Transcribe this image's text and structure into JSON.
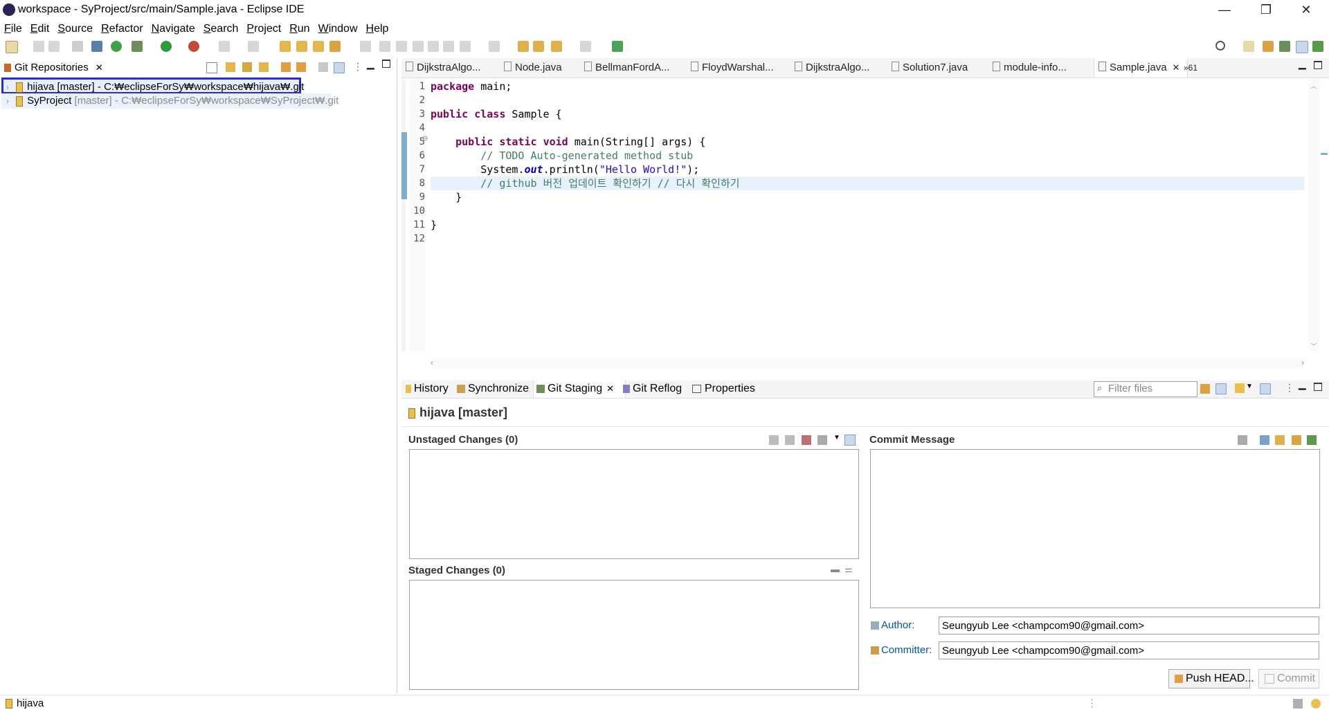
{
  "window": {
    "title": "workspace - SyProject/src/main/Sample.java - Eclipse IDE",
    "minimize": "—",
    "restore": "❐",
    "close": "✕"
  },
  "menu": [
    "File",
    "Edit",
    "Source",
    "Refactor",
    "Navigate",
    "Search",
    "Project",
    "Run",
    "Window",
    "Help"
  ],
  "git_repos_view": {
    "tab_label": "Git Repositories",
    "repos": [
      {
        "name": "hijava",
        "branch": "[master]",
        "path": "- C:₩eclipseForSy₩workspace₩hijava₩.git",
        "selected": true
      },
      {
        "name": "SyProject",
        "branch": "[master]",
        "path": "- C:₩eclipseForSy₩workspace₩SyProject₩.git",
        "selected": false
      }
    ]
  },
  "editor": {
    "tabs": [
      "DijkstraAlgo...",
      "Node.java",
      "BellmanFordA...",
      "FloydWarshal...",
      "DijkstraAlgo...",
      "Solution7.java",
      "module-info...",
      "Sample.java"
    ],
    "active_tab": "Sample.java",
    "overflow_count": "»61",
    "line_numbers": [
      "1",
      "2",
      "3",
      "4",
      "5",
      "6",
      "7",
      "8",
      "9",
      "10",
      "11",
      "12"
    ],
    "code": {
      "l1_kw": "package",
      "l1_rest": " main;",
      "l3_kw1": "public",
      "l3_kw2": "class",
      "l3_rest": " Sample {",
      "l5_kw1": "public",
      "l5_kw2": "static",
      "l5_kw3": "void",
      "l5_rest": " main(String[] args) {",
      "l6": "// TODO Auto-generated method stub",
      "l7_a": "System.",
      "l7_field": "out",
      "l7_b": ".println(",
      "l7_str": "\"Hello World!\"",
      "l7_c": ");",
      "l8": "// github 버전 업데이트 확인하기 // 다시 확인하기",
      "l9": "}",
      "l11": "}"
    }
  },
  "bottom_view": {
    "tabs": [
      "History",
      "Synchronize",
      "Git Staging",
      "Git Reflog",
      "Properties"
    ],
    "active_tab": "Git Staging",
    "filter_placeholder": "Filter files",
    "repo_header": "hijava [master]",
    "unstaged_label": "Unstaged Changes (0)",
    "staged_label": "Staged Changes (0)",
    "commit_message_label": "Commit Message",
    "author_label": "Author:",
    "author_value": "Seungyub Lee <champcom90@gmail.com>",
    "committer_label": "Committer:",
    "committer_value": "Seungyub Lee <champcom90@gmail.com>",
    "push_button": "Push HEAD...",
    "commit_button": "Commit"
  },
  "status_bar": {
    "text": "hijava"
  },
  "colors": {
    "selection_box": "#2b2bd4",
    "active_tab_bg": "#ffffff",
    "tab_strip_bg": "#f0f0f0",
    "current_line": "#e8f2fe",
    "ruler_marker": "#7fafca"
  }
}
